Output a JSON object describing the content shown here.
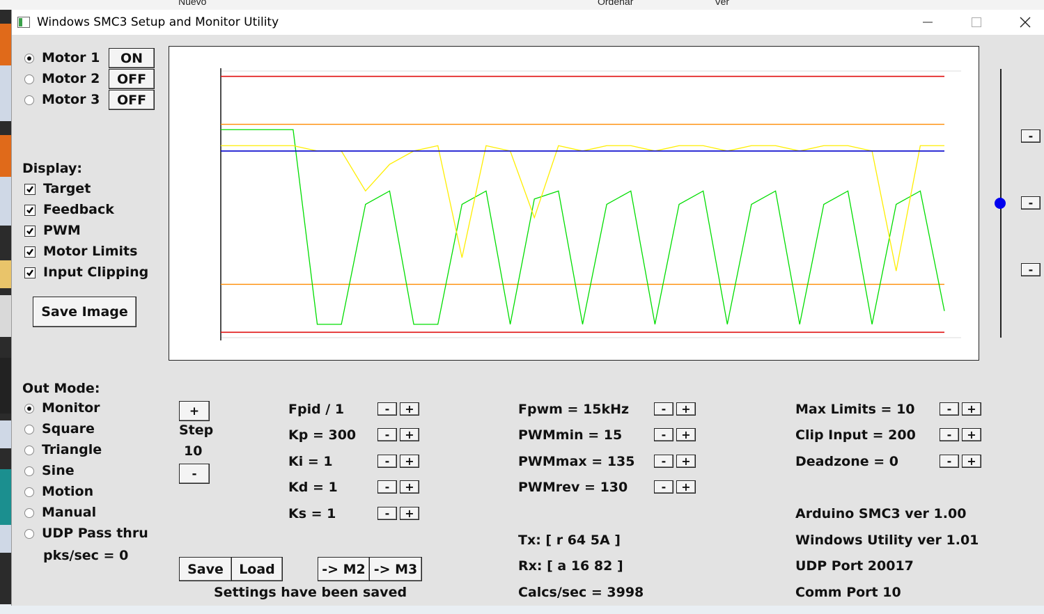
{
  "taskbar": {
    "nuevo": "Nuevo",
    "ordenar": "Ordenar",
    "ver": "Ver"
  },
  "window": {
    "title": "Windows SMC3 Setup and Monitor Utility"
  },
  "motors": [
    {
      "label": "Motor 1",
      "state": "ON",
      "selected": true
    },
    {
      "label": "Motor 2",
      "state": "OFF",
      "selected": false
    },
    {
      "label": "Motor 3",
      "state": "OFF",
      "selected": false
    }
  ],
  "display": {
    "heading": "Display:",
    "options": [
      {
        "label": "Target",
        "checked": true
      },
      {
        "label": "Feedback",
        "checked": true
      },
      {
        "label": "PWM",
        "checked": true
      },
      {
        "label": "Motor Limits",
        "checked": true
      },
      {
        "label": "Input Clipping",
        "checked": true
      }
    ],
    "save_image": "Save Image"
  },
  "out_mode": {
    "heading": "Out Mode:",
    "options": [
      {
        "label": "Monitor",
        "selected": true
      },
      {
        "label": "Square",
        "selected": false
      },
      {
        "label": "Triangle",
        "selected": false
      },
      {
        "label": "Sine",
        "selected": false
      },
      {
        "label": "Motion",
        "selected": false
      },
      {
        "label": "Manual",
        "selected": false
      },
      {
        "label": "UDP Pass thru",
        "selected": false
      }
    ],
    "pks": "pks/sec = 0"
  },
  "step": {
    "plus": "+",
    "label": "Step",
    "value": "10",
    "minus": "-"
  },
  "pid": [
    "Fpid / 1",
    "Kp = 300",
    "Ki = 1",
    "Kd = 1",
    "Ks = 1"
  ],
  "pwm": [
    "Fpwm = 15kHz",
    "PWMmin = 15",
    "PWMmax = 135",
    "PWMrev = 130"
  ],
  "limits": [
    "Max Limits = 10",
    "Clip Input = 200",
    "Deadzone = 0"
  ],
  "adjust": {
    "minus": "-",
    "plus": "+"
  },
  "status": {
    "tx": "Tx: [ r 64 5A ]",
    "rx": "Rx: [ a 16 82 ]",
    "calcs": "Calcs/sec = 3998",
    "arduino": "Arduino SMC3 ver 1.00",
    "utility": "Windows Utility ver 1.01",
    "udp": "UDP Port 20017",
    "comm": "Comm Port 10"
  },
  "actions": {
    "save": "Save",
    "load": "Load",
    "to_m2": "-> M2",
    "to_m3": "-> M3",
    "message": "Settings have been saved"
  },
  "slider": {
    "minus": "-"
  },
  "chart_data": {
    "type": "line",
    "series": [
      {
        "color": "#00dd00",
        "values": [
          0.78,
          0.78,
          0.78,
          0.78,
          0.05,
          0.05,
          0.5,
          0.55,
          0.05,
          0.05,
          0.5,
          0.55,
          0.05,
          0.52,
          0.55,
          0.05,
          0.5,
          0.55,
          0.05,
          0.5,
          0.55,
          0.05,
          0.5,
          0.55,
          0.05,
          0.5,
          0.55,
          0.05,
          0.5,
          0.55,
          0.1
        ]
      },
      {
        "color": "#ffee00",
        "values": [
          0.72,
          0.72,
          0.72,
          0.72,
          0.7,
          0.7,
          0.55,
          0.65,
          0.7,
          0.72,
          0.3,
          0.72,
          0.7,
          0.45,
          0.72,
          0.7,
          0.72,
          0.72,
          0.7,
          0.72,
          0.72,
          0.7,
          0.72,
          0.72,
          0.7,
          0.72,
          0.72,
          0.7,
          0.25,
          0.72,
          0.72
        ]
      },
      {
        "color": "#0000cc",
        "values": [
          0.7,
          0.7
        ]
      }
    ],
    "motor_limits": [
      0.02,
      0.98
    ],
    "input_clipping": [
      0.2,
      0.8
    ],
    "ylim": [
      0,
      1
    ],
    "grid": false
  }
}
